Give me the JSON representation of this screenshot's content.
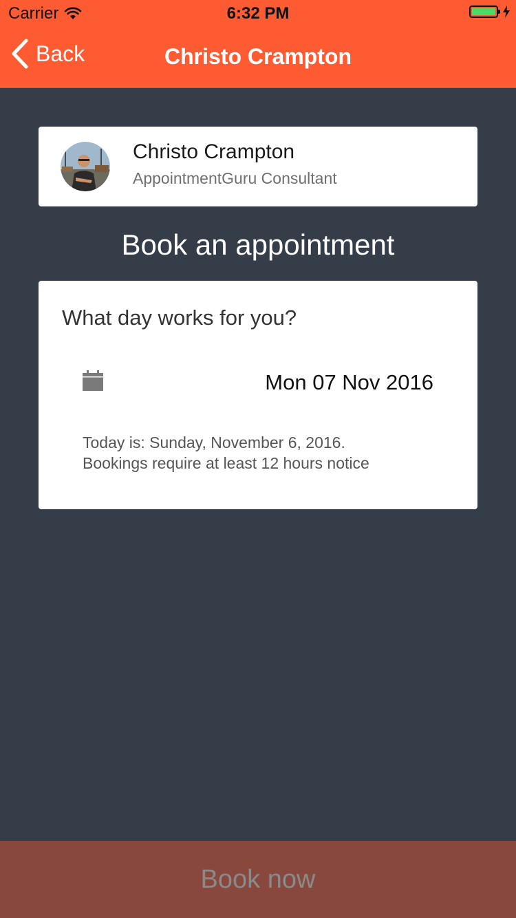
{
  "status_bar": {
    "carrier": "Carrier",
    "time": "6:32 PM",
    "battery_level": 1.0
  },
  "nav": {
    "back_label": "Back",
    "title": "Christo Crampton"
  },
  "consultant": {
    "name": "Christo Crampton",
    "role": "AppointmentGuru Consultant"
  },
  "section_title": "Book an appointment",
  "date_card": {
    "question": "What day works for you?",
    "selected_date": "Mon 07 Nov 2016",
    "note_today": "Today is: Sunday, November 6, 2016.",
    "note_notice": "Bookings require at least 12 hours notice"
  },
  "book_button_label": "Book now",
  "colors": {
    "header": "#ff5b33",
    "background": "#343d48",
    "book_button": "#88483e",
    "battery": "#4cd964"
  }
}
